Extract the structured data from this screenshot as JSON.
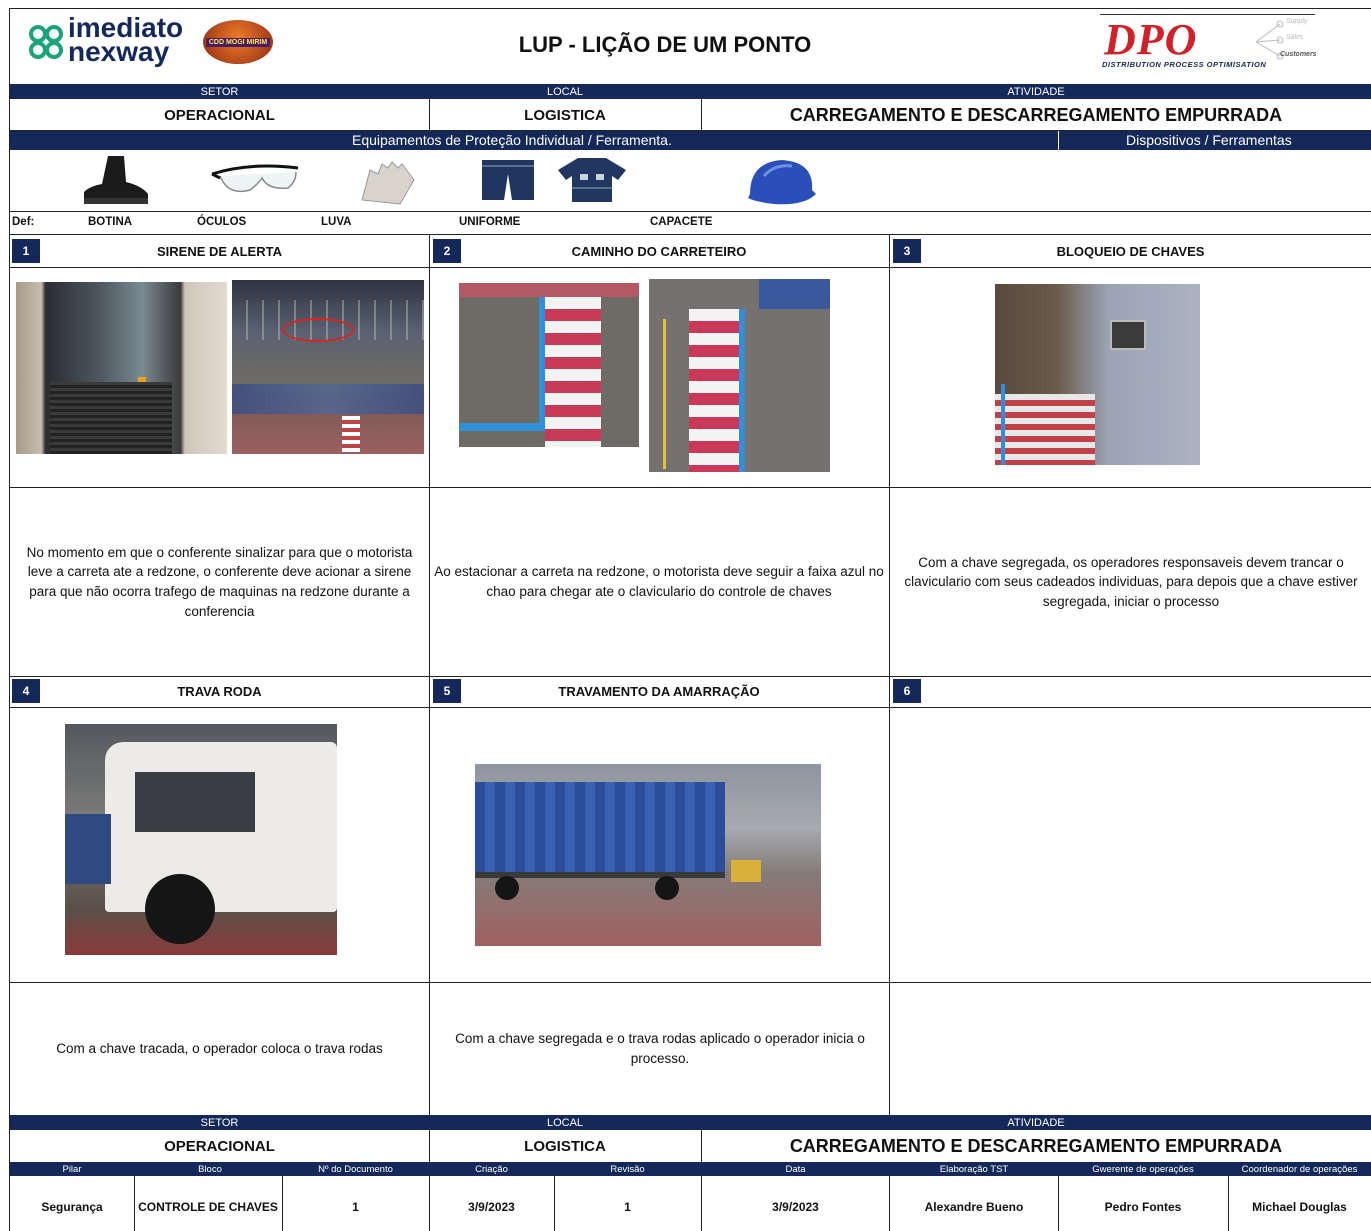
{
  "header": {
    "logo_line1": "imediato",
    "logo_line2": "nexway",
    "badge_text": "CDD MOGI MIRIM",
    "title": "LUP - LIÇÃO DE UM PONTO",
    "dpo_logo": "DPO",
    "dpo_tagline": "DISTRIBUTION PROCESS OPTIMISATION",
    "dpo_words": [
      "Supply",
      "Sales",
      "Customers"
    ]
  },
  "info_top": {
    "setor_label": "SETOR",
    "local_label": "LOCAL",
    "atividade_label": "ATIVIDADE",
    "setor": "OPERACIONAL",
    "local": "LOGISTICA",
    "atividade": "CARREGAMENTO E DESCARREGAMENTO EMPURRADA"
  },
  "ppe": {
    "section_label": "Equipamentos de Proteção Individual / Ferramenta.",
    "devices_label": "Dispositivos / Ferramentas",
    "def_label": "Def:",
    "items": [
      "BOTINA",
      "ÓCULOS",
      "LUVA",
      "UNIFORME",
      "CAPACETE"
    ]
  },
  "steps": [
    {
      "num": "1",
      "title": "SIRENE DE ALERTA",
      "text": "No momento em que o conferente sinalizar para que o motorista leve a carreta ate a redzone, o conferente deve acionar a sirene para que não ocorra trafego de maquinas na redzone durante a conferencia"
    },
    {
      "num": "2",
      "title": "CAMINHO DO CARRETEIRO",
      "text": "Ao estacionar a carreta na redzone, o motorista deve seguir a faixa azul no chao para chegar ate o claviculario do controle de chaves"
    },
    {
      "num": "3",
      "title": "BLOQUEIO DE CHAVES",
      "text": "Com a chave segregada, os operadores responsaveis devem trancar o claviculario com seus cadeados individuas, para depois que a chave estiver segregada, iniciar o processo"
    },
    {
      "num": "4",
      "title": "TRAVA RODA",
      "text": "Com a chave tracada, o operador coloca o trava rodas"
    },
    {
      "num": "5",
      "title": "TRAVAMENTO DA AMARRAÇÃO",
      "text": "Com a chave segregada e o trava rodas aplicado o operador inicia o processo."
    },
    {
      "num": "6",
      "title": "",
      "text": ""
    }
  ],
  "info_bottom": {
    "setor_label": "SETOR",
    "local_label": "LOCAL",
    "atividade_label": "ATIVIDADE",
    "setor": "OPERACIONAL",
    "local": "LOGISTICA",
    "atividade": "CARREGAMENTO E DESCARREGAMENTO EMPURRADA"
  },
  "footer": {
    "headers": [
      "Pilar",
      "Bloco",
      "Nº do Documento",
      "Criação",
      "Revisão",
      "Data",
      "Elaboração TST",
      "Gwerente de operações",
      "Coordenador de operações"
    ],
    "values": [
      "Segurança",
      "CONTROLE DE CHAVES",
      "1",
      "3/9/2023",
      "1",
      "3/9/2023",
      "Alexandre Bueno",
      "Pedro Fontes",
      "Michael Douglas"
    ]
  },
  "colors": {
    "navy": "#14285a",
    "logo_green": "#1ba37a",
    "dpo_red": "#d0202a",
    "step_blue": "#14285a"
  }
}
